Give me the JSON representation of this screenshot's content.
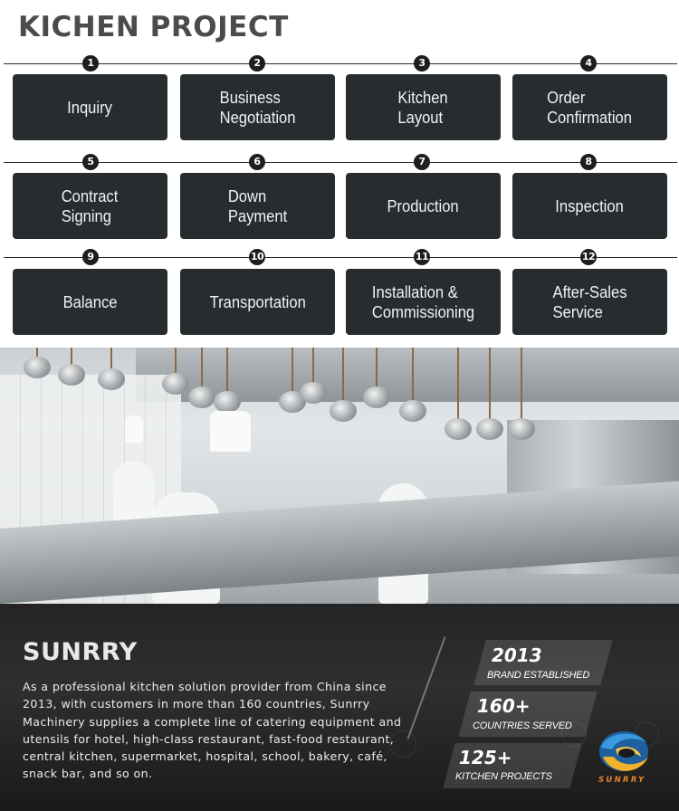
{
  "header": {
    "title": "KICHEN PROJECT"
  },
  "steps": [
    {
      "number": "1",
      "label": "Inquiry"
    },
    {
      "number": "2",
      "label": "Business\nNegotiation"
    },
    {
      "number": "3",
      "label": "Kitchen\nLayout"
    },
    {
      "number": "4",
      "label": "Order\nConfirmation"
    },
    {
      "number": "5",
      "label": "Contract\nSigning"
    },
    {
      "number": "6",
      "label": "Down\nPayment"
    },
    {
      "number": "7",
      "label": "Production"
    },
    {
      "number": "8",
      "label": "Inspection"
    },
    {
      "number": "9",
      "label": "Balance"
    },
    {
      "number": "10",
      "label": "Transportation"
    },
    {
      "number": "11",
      "label": "Installation &\nCommissioning"
    },
    {
      "number": "12",
      "label": "After-Sales\nService"
    }
  ],
  "photo": {
    "description": "commercial-kitchen-chefs-photo"
  },
  "about": {
    "brand": "SUNRRY",
    "description": "As a professional kitchen solution provider from China since 2013, with customers in more than 160 countries, Sunrry Machinery supplies a complete line of catering equipment and utensils for hotel, high-class restaurant, fast-food restaurant, central kitchen, supermarket, hospital, school, bakery, café, snack bar, and so on.",
    "stats": [
      {
        "value": "2013",
        "label": "BRAND ESTABLISHED"
      },
      {
        "value": "160+",
        "label": "COUNTRIES SERVED"
      },
      {
        "value": "125+",
        "label": "KITCHEN PROJECTS"
      }
    ],
    "logo_text": "SUNRRY"
  },
  "colors": {
    "step_bg": "#272c2f",
    "title": "#4a4b4d",
    "logo_blue": "#2f8fd6",
    "logo_yellow": "#f2b12a",
    "logo_text": "#e8832b"
  }
}
